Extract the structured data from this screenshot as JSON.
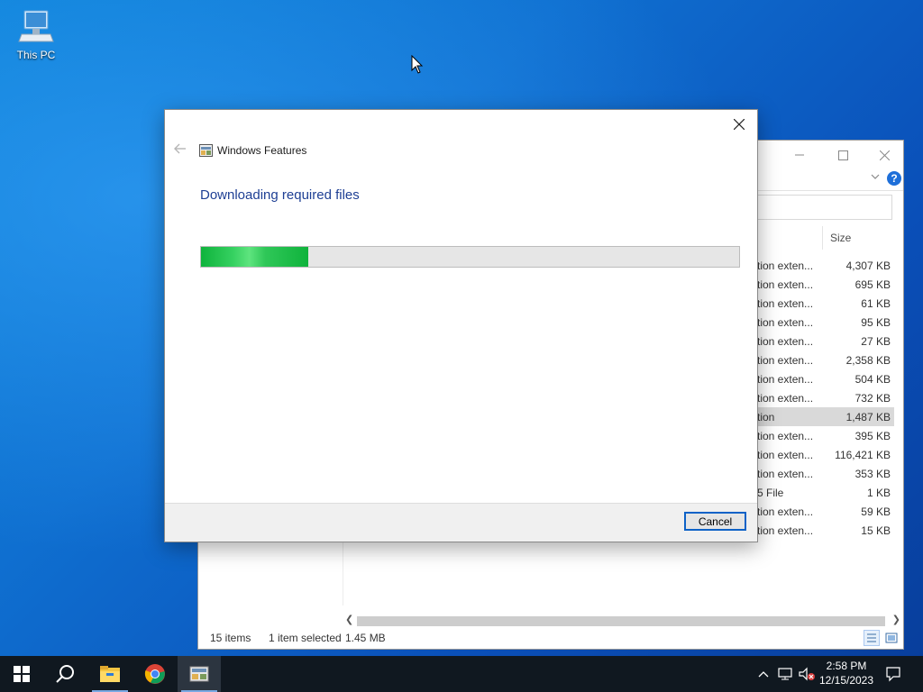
{
  "desktop": {
    "icons": [
      {
        "label": "This PC",
        "icon": "this-pc-icon"
      }
    ]
  },
  "dialog": {
    "title": "Windows Features",
    "heading": "Downloading required files",
    "progress_fraction": 0.2,
    "cancel_label": "Cancel"
  },
  "explorer": {
    "column_size_label": "Size",
    "rows": [
      {
        "type": "tion exten...",
        "size": "4,307 KB"
      },
      {
        "type": "tion exten...",
        "size": "695 KB"
      },
      {
        "type": "tion exten...",
        "size": "61 KB"
      },
      {
        "type": "tion exten...",
        "size": "95 KB"
      },
      {
        "type": "tion exten...",
        "size": "27 KB"
      },
      {
        "type": "tion exten...",
        "size": "2,358 KB"
      },
      {
        "type": "tion exten...",
        "size": "504 KB"
      },
      {
        "type": "tion exten...",
        "size": "732 KB"
      },
      {
        "type": "tion",
        "size": "1,487 KB",
        "selected": true
      },
      {
        "type": "tion exten...",
        "size": "395 KB"
      },
      {
        "type": "tion exten...",
        "size": "116,421 KB"
      },
      {
        "type": "tion exten...",
        "size": "353 KB"
      },
      {
        "type": "5 File",
        "size": "1 KB"
      },
      {
        "type": "tion exten...",
        "size": "59 KB"
      },
      {
        "type": "tion exten...",
        "size": "15 KB"
      }
    ],
    "status": {
      "items": "15 items",
      "selected": "1 item selected",
      "size": "1.45 MB"
    }
  },
  "taskbar": {
    "clock_time": "2:58 PM",
    "clock_date": "12/15/2023"
  },
  "colors": {
    "accent": "#0d62c7",
    "heading": "#1e3f94",
    "progress": "#0fb33c",
    "taskbar": "#101820"
  }
}
